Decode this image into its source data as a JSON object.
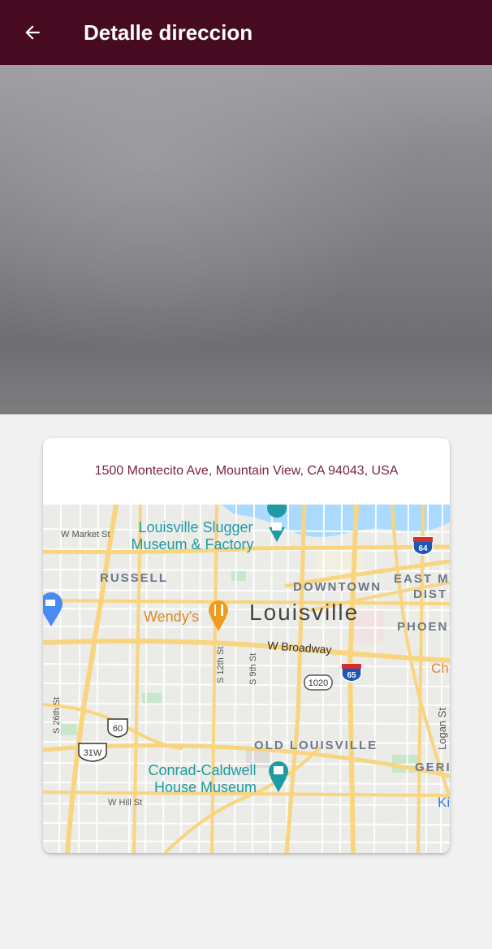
{
  "header": {
    "title": "Detalle direccion",
    "back_icon": "arrow-left-icon"
  },
  "colors": {
    "app_bar": "#460b20",
    "address_text": "#7a1f45",
    "background": "#f1f1f1"
  },
  "card": {
    "address": "1500 Montecito Ave, Mountain View, CA 94043, USA"
  },
  "map": {
    "city": "Louisville",
    "poi": {
      "slugger_line1": "Louisville Slugger",
      "slugger_line2": "Museum & Factory",
      "wendys": "Wendy's",
      "conrad_line1": "Conrad-Caldwell",
      "conrad_line2": "House Museum"
    },
    "neighborhoods": {
      "russell": "RUSSELL",
      "downtown": "DOWNTOWN",
      "east": "EAST M",
      "dist": "DIST",
      "phoenix": "PHOEN",
      "old_louisville": "OLD LOUISVILLE",
      "ger": "GERI"
    },
    "streets": {
      "w_market": "W Market St",
      "w_broadway": "W Broadway",
      "s_12th": "S 12th St",
      "s_9th": "S 9th St",
      "s_26th": "S 26th St",
      "w_hill": "W Hill St",
      "logan": "Logan St"
    },
    "shields": {
      "i64": "64",
      "i65": "65",
      "r1020": "1020",
      "us60": "60",
      "us31w": "31W"
    },
    "edge": {
      "ch": "Ch",
      "ki": "Ki"
    }
  }
}
